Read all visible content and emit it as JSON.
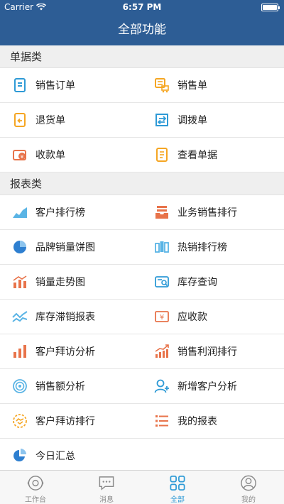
{
  "status_bar": {
    "carrier": "Carrier",
    "time": "6:57 PM"
  },
  "nav": {
    "title": "全部功能"
  },
  "sections": [
    {
      "title": "单据类",
      "items": [
        {
          "label": "销售订单",
          "icon": "sales-order-icon",
          "color": "#2e9ad6"
        },
        {
          "label": "销售单",
          "icon": "sales-receipt-icon",
          "color": "#f5a623"
        },
        {
          "label": "退货单",
          "icon": "return-order-icon",
          "color": "#f5a623"
        },
        {
          "label": "调拨单",
          "icon": "transfer-order-icon",
          "color": "#2e9ad6"
        },
        {
          "label": "收款单",
          "icon": "payment-receipt-icon",
          "color": "#e8734a"
        },
        {
          "label": "查看单据",
          "icon": "view-documents-icon",
          "color": "#f5a623"
        }
      ]
    },
    {
      "title": "报表类",
      "items": [
        {
          "label": "客户排行榜",
          "icon": "area-chart-icon",
          "color": "#5ab4e5"
        },
        {
          "label": "业务销售排行",
          "icon": "stack-tray-icon",
          "color": "#e8734a"
        },
        {
          "label": "品牌销量饼图",
          "icon": "pie-chart-icon",
          "color": "#2e7fd0"
        },
        {
          "label": "热销排行榜",
          "icon": "hot-sales-icon",
          "color": "#5ab4e5"
        },
        {
          "label": "销量走势图",
          "icon": "trend-bar-icon",
          "color": "#e8734a"
        },
        {
          "label": "库存查询",
          "icon": "inventory-search-icon",
          "color": "#2e9ad6"
        },
        {
          "label": "库存滞销报表",
          "icon": "slow-moving-icon",
          "color": "#5ab4e5"
        },
        {
          "label": "应收款",
          "icon": "receivable-icon",
          "color": "#e8734a"
        },
        {
          "label": "客户拜访分析",
          "icon": "bar-chart-icon",
          "color": "#e8734a"
        },
        {
          "label": "销售利润排行",
          "icon": "profit-chart-icon",
          "color": "#e8734a"
        },
        {
          "label": "销售额分析",
          "icon": "sales-amount-icon",
          "color": "#5ab4e5"
        },
        {
          "label": "新增客户分析",
          "icon": "add-customer-icon",
          "color": "#2e9ad6"
        },
        {
          "label": "客户拜访排行",
          "icon": "handshake-icon",
          "color": "#f5a623"
        },
        {
          "label": "我的报表",
          "icon": "list-icon",
          "color": "#e8734a"
        },
        {
          "label": "今日汇总",
          "icon": "daily-summary-icon",
          "color": "#2e7fd0"
        }
      ]
    }
  ],
  "tabs": [
    {
      "label": "工作台",
      "icon": "workbench-icon",
      "active": false
    },
    {
      "label": "消息",
      "icon": "message-icon",
      "active": false
    },
    {
      "label": "全部",
      "icon": "grid-icon",
      "active": true
    },
    {
      "label": "我的",
      "icon": "profile-icon",
      "active": false
    }
  ],
  "colors": {
    "nav_bg": "#2d5d95",
    "accent": "#2e9ad6",
    "section_bg": "#efefef"
  }
}
